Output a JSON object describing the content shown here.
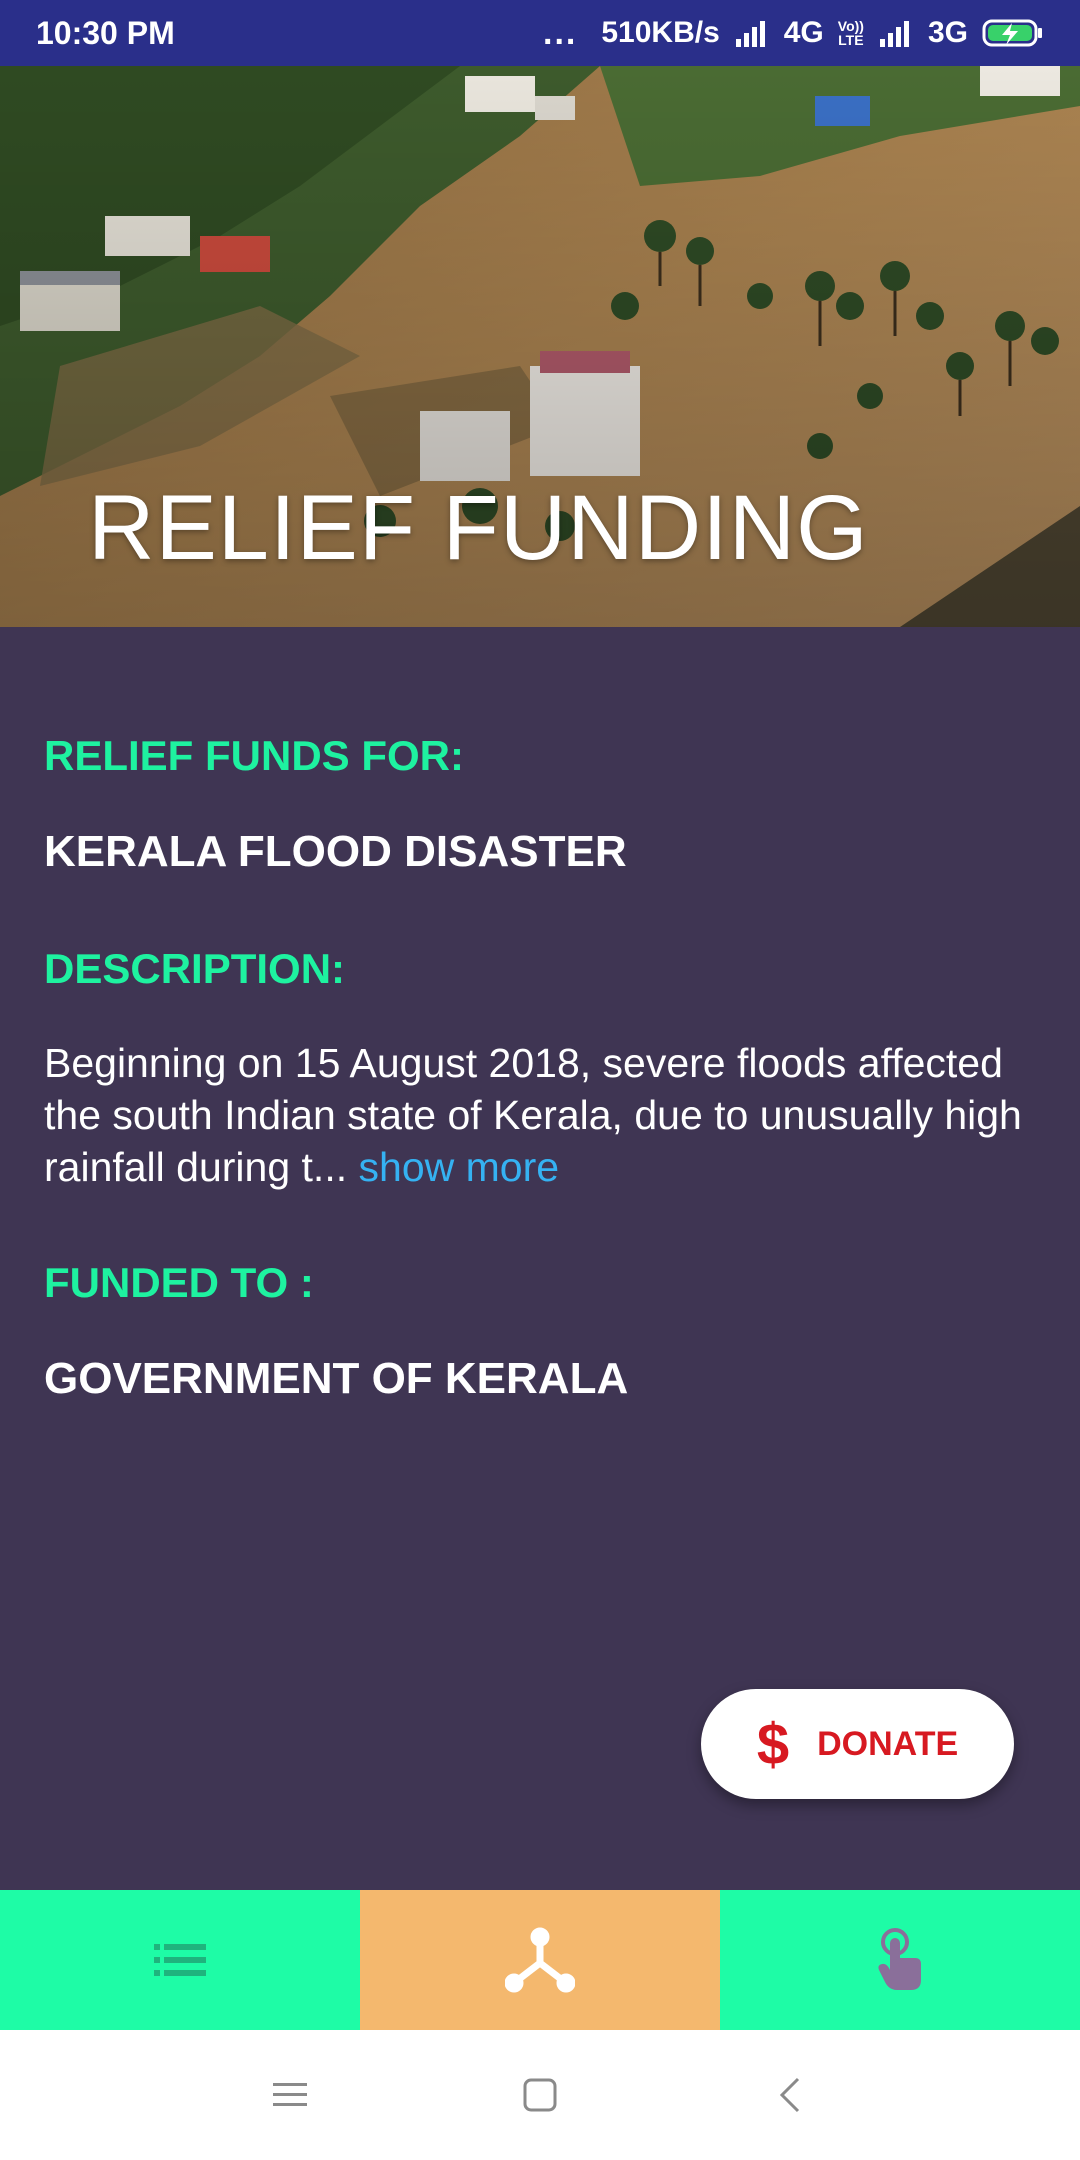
{
  "status_bar": {
    "time": "10:30 PM",
    "dots": "...",
    "speed": "510KB/s",
    "network1": "4G",
    "volte_top": "Vo))",
    "volte_bottom": "LTE",
    "network2": "3G"
  },
  "hero": {
    "title": "RELIEF FUNDING"
  },
  "details": {
    "funds_for_label": "RELIEF FUNDS FOR:",
    "funds_for_value": "KERALA FLOOD DISASTER",
    "description_label": "DESCRIPTION:",
    "description_text": "Beginning on 15 August 2018, severe floods affected the south Indian state of Kerala, due to unusually high rainfall during t...",
    "show_more": "show more",
    "funded_to_label": "FUNDED TO :",
    "funded_to_value": "GOVERNMENT OF KERALA"
  },
  "donate_button": {
    "icon": "$",
    "label": "DONATE"
  },
  "bottom_tabs": [
    {
      "icon": "list-icon"
    },
    {
      "icon": "network-icon"
    },
    {
      "icon": "touch-icon"
    }
  ],
  "colors": {
    "status_bar": "#2a2f8a",
    "content_bg": "#3f3553",
    "accent_green": "#1ef2a0",
    "link_blue": "#35b2f2",
    "donate_red": "#d71921",
    "tab_green": "#1efca6",
    "tab_active": "#f4b86e"
  }
}
